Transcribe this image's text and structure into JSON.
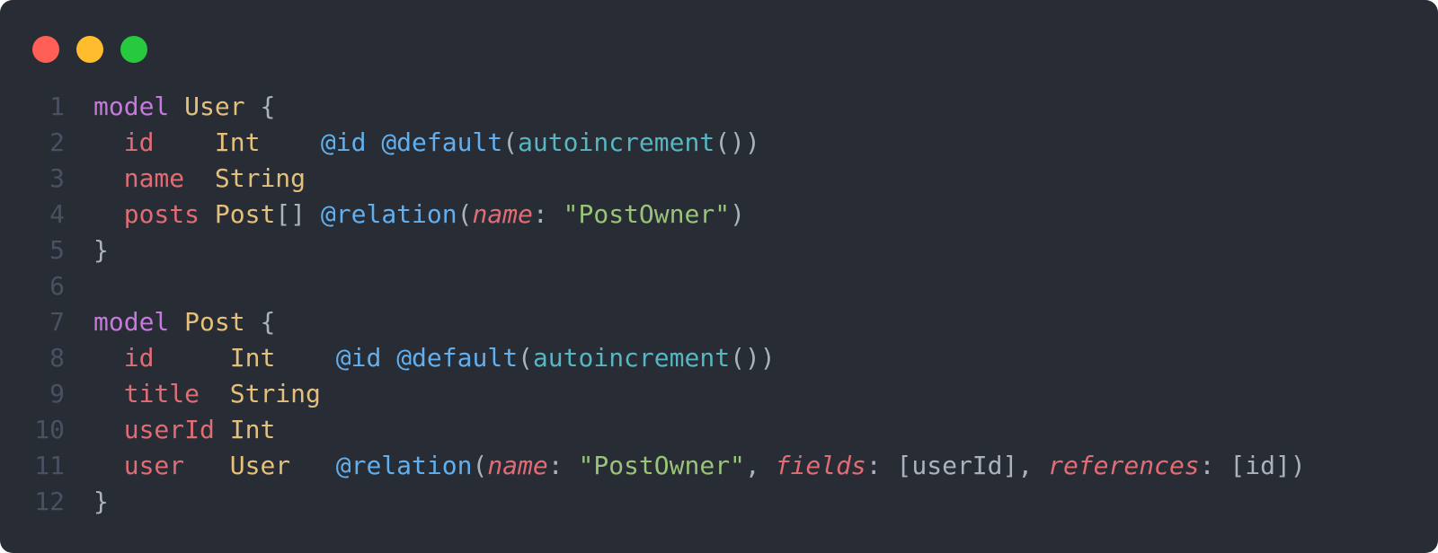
{
  "colors": {
    "background": "#282c34",
    "keyword": "#c678dd",
    "type": "#e5c07b",
    "field": "#e06c75",
    "attribute": "#61afef",
    "function": "#56b6c2",
    "string": "#98c379",
    "punctuation": "#abb2bf",
    "line_number": "#495162",
    "close_dot": "#ff5f56",
    "minimize_dot": "#ffbd2e",
    "maximize_dot": "#27c93f"
  },
  "window_controls": [
    "close-dot",
    "minimize-dot",
    "maximize-dot"
  ],
  "code_lines": [
    [
      {
        "t": "model",
        "c": "kw"
      },
      {
        "t": " ",
        "c": "punc"
      },
      {
        "t": "User",
        "c": "type"
      },
      {
        "t": " {",
        "c": "punc"
      }
    ],
    [
      {
        "t": "  ",
        "c": "punc"
      },
      {
        "t": "id",
        "c": "field"
      },
      {
        "t": "    ",
        "c": "punc"
      },
      {
        "t": "Int",
        "c": "type"
      },
      {
        "t": "    ",
        "c": "punc"
      },
      {
        "t": "@id",
        "c": "attr"
      },
      {
        "t": " ",
        "c": "punc"
      },
      {
        "t": "@default",
        "c": "attr"
      },
      {
        "t": "(",
        "c": "punc"
      },
      {
        "t": "autoincrement",
        "c": "fn"
      },
      {
        "t": "())",
        "c": "punc"
      }
    ],
    [
      {
        "t": "  ",
        "c": "punc"
      },
      {
        "t": "name",
        "c": "field"
      },
      {
        "t": "  ",
        "c": "punc"
      },
      {
        "t": "String",
        "c": "type"
      }
    ],
    [
      {
        "t": "  ",
        "c": "punc"
      },
      {
        "t": "posts",
        "c": "field"
      },
      {
        "t": " ",
        "c": "punc"
      },
      {
        "t": "Post",
        "c": "type"
      },
      {
        "t": "[] ",
        "c": "punc"
      },
      {
        "t": "@relation",
        "c": "attr"
      },
      {
        "t": "(",
        "c": "punc"
      },
      {
        "t": "name",
        "c": "arg"
      },
      {
        "t": ": ",
        "c": "punc"
      },
      {
        "t": "\"PostOwner\"",
        "c": "str"
      },
      {
        "t": ")",
        "c": "punc"
      }
    ],
    [
      {
        "t": "}",
        "c": "punc"
      }
    ],
    [],
    [
      {
        "t": "model",
        "c": "kw"
      },
      {
        "t": " ",
        "c": "punc"
      },
      {
        "t": "Post",
        "c": "type"
      },
      {
        "t": " {",
        "c": "punc"
      }
    ],
    [
      {
        "t": "  ",
        "c": "punc"
      },
      {
        "t": "id",
        "c": "field"
      },
      {
        "t": "     ",
        "c": "punc"
      },
      {
        "t": "Int",
        "c": "type"
      },
      {
        "t": "    ",
        "c": "punc"
      },
      {
        "t": "@id",
        "c": "attr"
      },
      {
        "t": " ",
        "c": "punc"
      },
      {
        "t": "@default",
        "c": "attr"
      },
      {
        "t": "(",
        "c": "punc"
      },
      {
        "t": "autoincrement",
        "c": "fn"
      },
      {
        "t": "())",
        "c": "punc"
      }
    ],
    [
      {
        "t": "  ",
        "c": "punc"
      },
      {
        "t": "title",
        "c": "field"
      },
      {
        "t": "  ",
        "c": "punc"
      },
      {
        "t": "String",
        "c": "type"
      }
    ],
    [
      {
        "t": "  ",
        "c": "punc"
      },
      {
        "t": "userId",
        "c": "field"
      },
      {
        "t": " ",
        "c": "punc"
      },
      {
        "t": "Int",
        "c": "type"
      }
    ],
    [
      {
        "t": "  ",
        "c": "punc"
      },
      {
        "t": "user",
        "c": "field"
      },
      {
        "t": "   ",
        "c": "punc"
      },
      {
        "t": "User",
        "c": "type"
      },
      {
        "t": "   ",
        "c": "punc"
      },
      {
        "t": "@relation",
        "c": "attr"
      },
      {
        "t": "(",
        "c": "punc"
      },
      {
        "t": "name",
        "c": "arg"
      },
      {
        "t": ": ",
        "c": "punc"
      },
      {
        "t": "\"PostOwner\"",
        "c": "str"
      },
      {
        "t": ", ",
        "c": "punc"
      },
      {
        "t": "fields",
        "c": "arg"
      },
      {
        "t": ": [userId], ",
        "c": "punc"
      },
      {
        "t": "references",
        "c": "arg"
      },
      {
        "t": ": [id])",
        "c": "punc"
      }
    ],
    [
      {
        "t": "}",
        "c": "punc"
      }
    ]
  ],
  "line_numbers": [
    "1",
    "2",
    "3",
    "4",
    "5",
    "6",
    "7",
    "8",
    "9",
    "10",
    "11",
    "12"
  ]
}
